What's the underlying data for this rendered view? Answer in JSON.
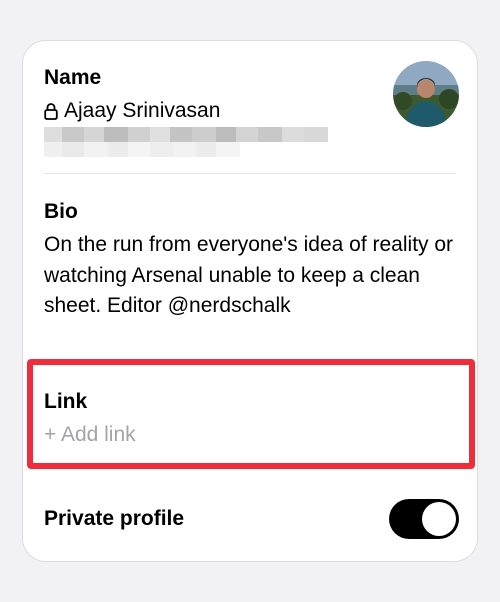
{
  "profile": {
    "name_title": "Name",
    "name_value": "Ajaay Srinivasan",
    "bio_title": "Bio",
    "bio_text": "On the run from everyone's idea of reality or watching Arsenal unable to keep a clean sheet. Editor @nerdschalk",
    "link_title": "Link",
    "link_placeholder": "+ Add link",
    "private_label": "Private profile",
    "private_enabled": true
  },
  "icons": {
    "lock": "lock-icon",
    "avatar": "profile-photo"
  },
  "colors": {
    "highlight": "#ee2d3b",
    "toggle_on": "#000000",
    "placeholder": "#a3a3a8"
  }
}
